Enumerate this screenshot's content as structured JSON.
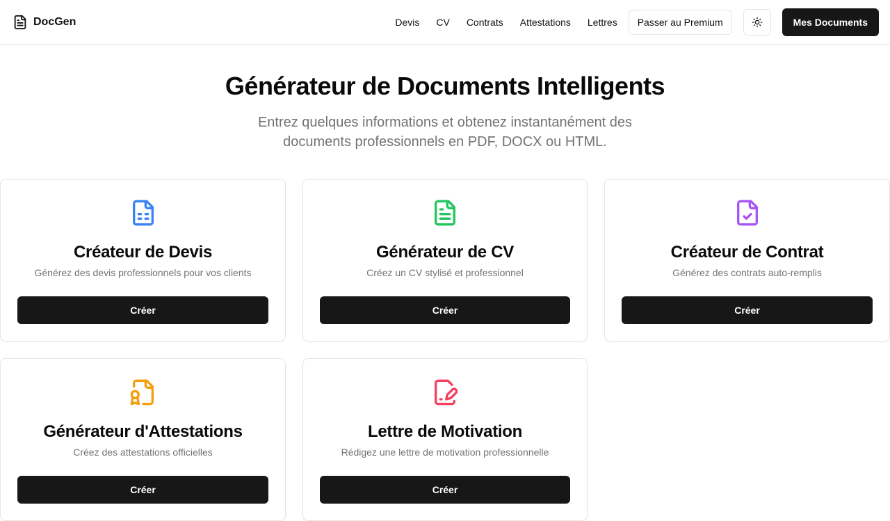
{
  "brand": {
    "name": "DocGen",
    "icon": "file-text-icon"
  },
  "nav": {
    "links": [
      "Devis",
      "CV",
      "Contrats",
      "Attestations",
      "Lettres"
    ],
    "premium_label": "Passer au Premium",
    "theme_icon": "sun-icon",
    "documents_label": "Mes Documents"
  },
  "hero": {
    "title": "Générateur de Documents Intelligents",
    "subtitle": "Entrez quelques informations et obtenez instantanément des documents professionnels en PDF, DOCX ou HTML."
  },
  "cards": [
    {
      "title": "Créateur de Devis",
      "description": "Générez des devis professionnels pour vos clients",
      "button": "Créer",
      "icon": "file-spreadsheet-icon",
      "color": "#3b82f6"
    },
    {
      "title": "Générateur de CV",
      "description": "Créez un CV stylisé et professionnel",
      "button": "Créer",
      "icon": "file-text-icon",
      "color": "#22c55e"
    },
    {
      "title": "Créateur de Contrat",
      "description": "Générez des contrats auto-remplis",
      "button": "Créer",
      "icon": "file-check-icon",
      "color": "#a855f7"
    },
    {
      "title": "Générateur d'Attestations",
      "description": "Créez des attestations officielles",
      "button": "Créer",
      "icon": "file-badge-icon",
      "color": "#f59e0b"
    },
    {
      "title": "Lettre de Motivation",
      "description": "Rédigez une lettre de motivation professionnelle",
      "button": "Créer",
      "icon": "file-signature-icon",
      "color": "#f43f5e"
    }
  ]
}
